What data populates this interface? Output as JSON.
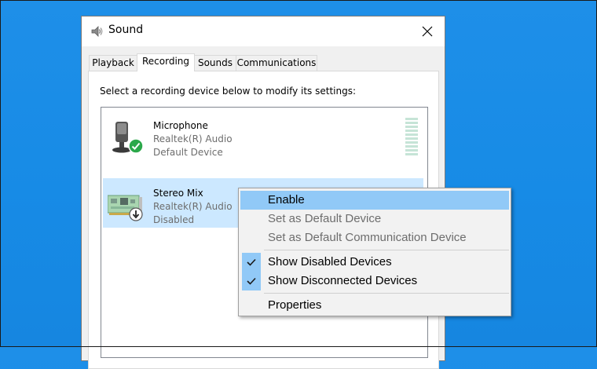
{
  "window": {
    "title": "Sound",
    "close_label": "close"
  },
  "tabs": [
    {
      "label": "Playback",
      "active": false
    },
    {
      "label": "Recording",
      "active": true
    },
    {
      "label": "Sounds",
      "active": false
    },
    {
      "label": "Communications",
      "active": false
    }
  ],
  "recording": {
    "instruction": "Select a recording device below to modify its settings:",
    "devices": [
      {
        "name": "Microphone",
        "driver": "Realtek(R) Audio",
        "status": "Default Device",
        "icon": "microphone-icon",
        "badge": "default-check-badge",
        "selected": false
      },
      {
        "name": "Stereo Mix",
        "driver": "Realtek(R) Audio",
        "status": "Disabled",
        "icon": "sound-card-icon",
        "badge": "disabled-arrow-badge",
        "selected": true
      }
    ]
  },
  "context_menu": {
    "items": [
      {
        "label": "Enable",
        "highlighted": true,
        "disabled": false,
        "checked": false
      },
      {
        "label": "Set as Default Device",
        "disabled": true,
        "checked": false
      },
      {
        "label": "Set as Default Communication Device",
        "disabled": true,
        "checked": false
      },
      {
        "label": "Show Disabled Devices",
        "disabled": false,
        "checked": true
      },
      {
        "label": "Show Disconnected Devices",
        "disabled": false,
        "checked": true
      },
      {
        "label": "Properties",
        "disabled": false,
        "checked": false
      }
    ]
  },
  "colors": {
    "desktop": "#1a8ae6",
    "selection": "#cce8ff",
    "menu_highlight": "#91c9f7",
    "default_badge": "#2ba84a"
  }
}
